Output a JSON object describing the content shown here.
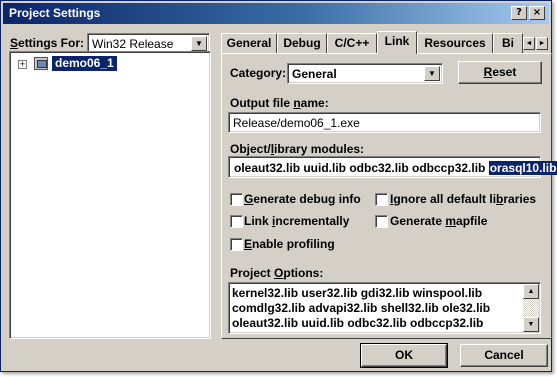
{
  "window": {
    "title": "Project Settings",
    "help_button": "?",
    "close_button": "×"
  },
  "left_panel": {
    "settings_for_label": "Settings For:",
    "settings_for_value": "Win32 Release",
    "tree": [
      {
        "label": "demo06_1",
        "expander": "+",
        "icon": "project-icon",
        "selected": true
      }
    ]
  },
  "tabs": {
    "items": [
      "General",
      "Debug",
      "C/C++",
      "Link",
      "Resources",
      "Bi"
    ],
    "active": "Link",
    "scroll_left": "◄",
    "scroll_right": "►"
  },
  "link_panel": {
    "category_label": "Category:",
    "category_value": "General",
    "reset_button": "Reset",
    "output_file_label": "Output file name:",
    "output_file_value": "Release/demo06_1.exe",
    "modules_label": "Object/library modules:",
    "modules_value": "oleaut32.lib uuid.lib odbc32.lib odbccp32.lib",
    "modules_selected": "orasql10.lib",
    "checkboxes": {
      "generate_debug_info": {
        "label": "Generate debug info",
        "checked": false
      },
      "ignore_default_libs": {
        "label": "Ignore all default libraries",
        "checked": false
      },
      "link_incrementally": {
        "label": "Link incrementally",
        "checked": false
      },
      "generate_mapfile": {
        "label": "Generate mapfile",
        "checked": false
      },
      "enable_profiling": {
        "label": "Enable profiling",
        "checked": false
      }
    },
    "project_options_label": "Project Options:",
    "project_options_lines": [
      "kernel32.lib user32.lib gdi32.lib winspool.lib",
      "comdlg32.lib advapi32.lib shell32.lib ole32.lib",
      "oleaut32.lib uuid.lib odbc32.lib odbccp32.lib"
    ],
    "scroll_up": "▲",
    "scroll_down": "▼"
  },
  "footer": {
    "ok_button": "OK",
    "cancel_button": "Cancel"
  }
}
